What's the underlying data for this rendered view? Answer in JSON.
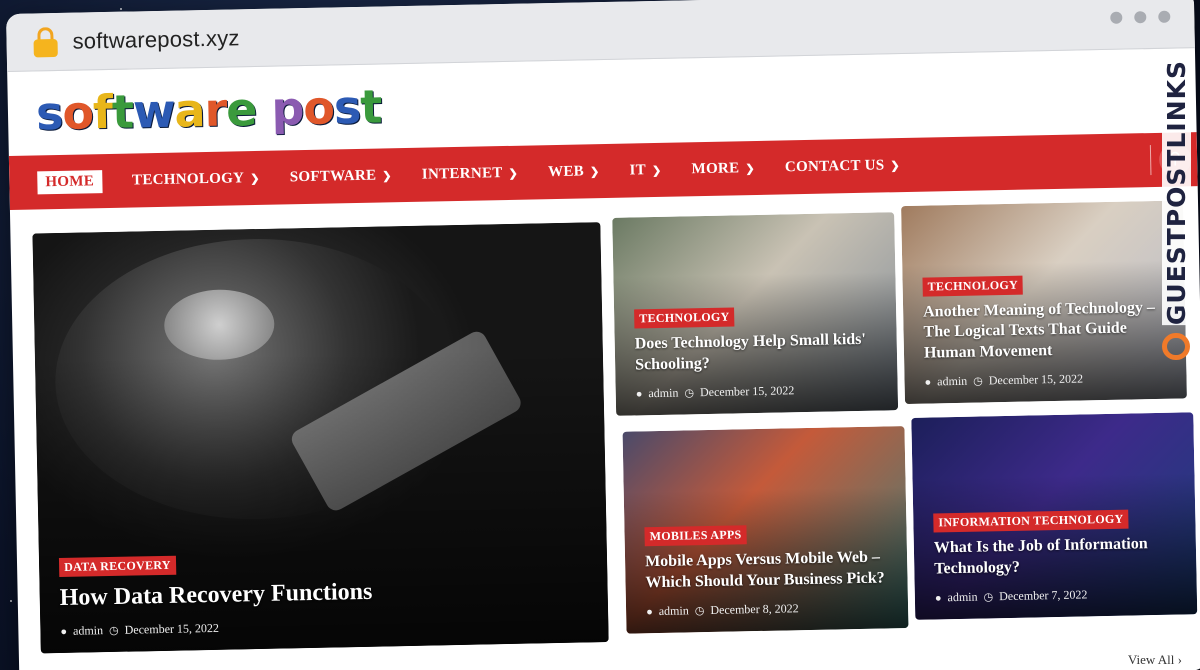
{
  "browser": {
    "url": "softwarepost.xyz"
  },
  "site": {
    "logo": "softwarepost"
  },
  "nav": {
    "items": [
      {
        "label": "HOME",
        "active": true,
        "dropdown": false
      },
      {
        "label": "TECHNOLOGY",
        "dropdown": true
      },
      {
        "label": "SOFTWARE",
        "dropdown": true
      },
      {
        "label": "INTERNET",
        "dropdown": true
      },
      {
        "label": "WEB",
        "dropdown": true
      },
      {
        "label": "IT",
        "dropdown": true
      },
      {
        "label": "MORE",
        "dropdown": true
      },
      {
        "label": "CONTACT US",
        "dropdown": true
      }
    ]
  },
  "featured": {
    "tag": "DATA RECOVERY",
    "title": "How Data Recovery Functions",
    "author": "admin",
    "date": "December 15, 2022"
  },
  "posts": [
    {
      "tag": "TECHNOLOGY",
      "title": "Does Technology Help Small kids' Schooling?",
      "author": "admin",
      "date": "December 15, 2022"
    },
    {
      "tag": "TECHNOLOGY",
      "title": "Another Meaning of Technology – The Logical Texts That Guide Human Movement",
      "author": "admin",
      "date": "December 15, 2022"
    },
    {
      "tag": "MOBILES APPS",
      "title": "Mobile Apps Versus Mobile Web – Which Should Your Business Pick?",
      "author": "admin",
      "date": "December 8, 2022"
    },
    {
      "tag": "INFORMATION TECHNOLOGY",
      "title": "What Is the Job of Information Technology?",
      "author": "admin",
      "date": "December 7, 2022"
    }
  ],
  "footer": {
    "view_all": "View All"
  },
  "watermark": {
    "text": "GUESTPOSTLINKS"
  },
  "colors": {
    "accent": "#d42a2a",
    "lock": "#f5b41e"
  },
  "icons": {
    "user": "user-icon",
    "clock": "clock-icon",
    "chevron": "chevron-down-icon",
    "search": "search-icon"
  }
}
